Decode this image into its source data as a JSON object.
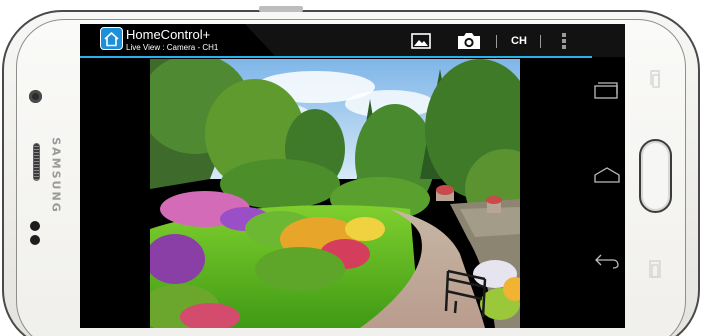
{
  "device": {
    "brand": "SAMSUNG"
  },
  "app": {
    "title": "HomeControl+",
    "subtitle": "Live View : Camera - CH1",
    "accent_color": "#2ab0ea",
    "home_icon": "home-icon"
  },
  "toolbar": {
    "gallery_icon": "image-gallery-icon",
    "camera_icon": "camera-icon",
    "channel_label": "CH",
    "more_icon": "overflow-menu-icon"
  },
  "camera_view": {
    "scene": "garden-live-feed"
  },
  "navigation": {
    "recent_icon": "recent-apps-icon",
    "home_icon": "home-outline-icon",
    "back_icon": "back-icon"
  }
}
